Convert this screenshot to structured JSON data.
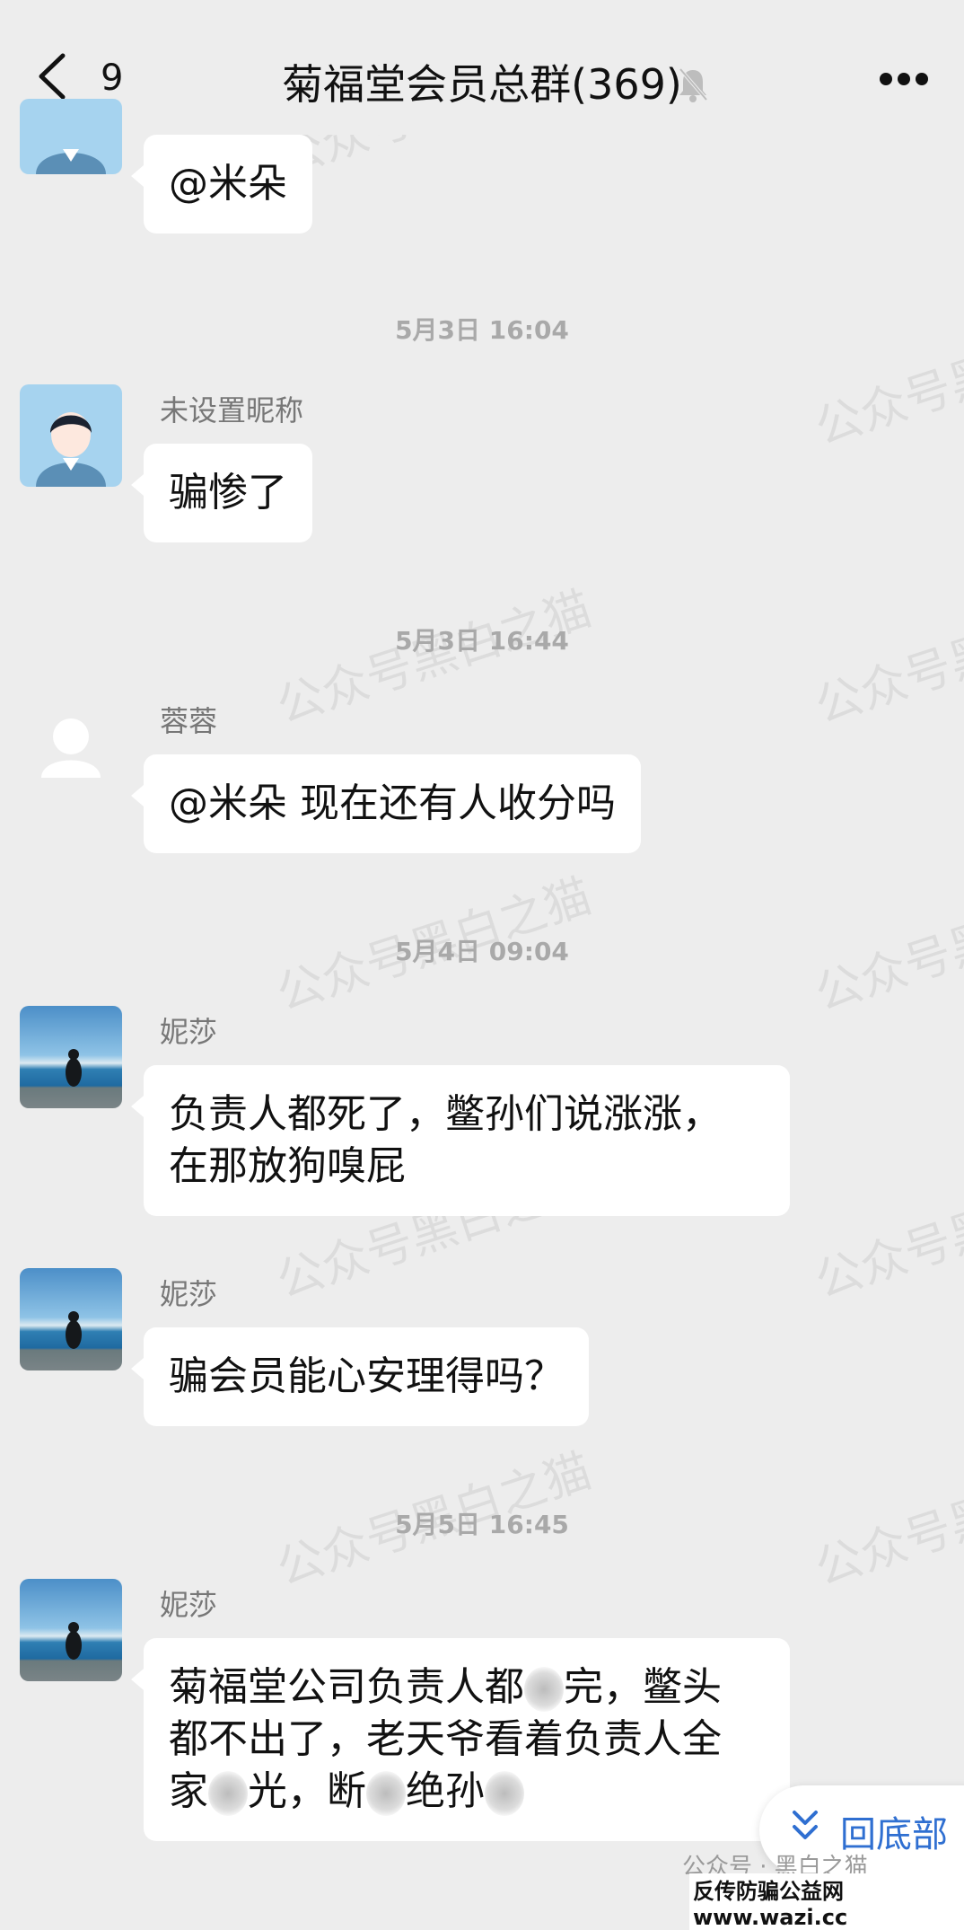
{
  "header": {
    "unread_count": "9",
    "title": "菊福堂会员总群(369)",
    "muted": true
  },
  "messages": [
    {
      "text": "@米朵"
    },
    {
      "time": "5月3日 16:04",
      "nickname": "未设置昵称",
      "text": "骗惨了"
    },
    {
      "time": "5月3日 16:44",
      "nickname": "蓉蓉",
      "text": "@米朵 现在还有人收分吗"
    },
    {
      "time": "5月4日 09:04",
      "nickname": "妮莎",
      "line1": "负责人都死了，鳖孙们说涨涨，",
      "line2": "在那放狗嗅屁"
    },
    {
      "nickname": "妮莎",
      "text": "骗会员能心安理得吗？"
    },
    {
      "time": "5月5日 16:45",
      "nickname": "妮莎",
      "line1a": "菊福堂公司负责人都",
      "line1b": "完，鳖头",
      "line2": "都不出了，老天爷看着负责人全",
      "line3a": "家",
      "line3b": "光，断",
      "line3c": "绝孙"
    }
  ],
  "watermark": "公众号黑白之猫",
  "to_bottom": {
    "label": "回底部"
  },
  "footer": {
    "source": "公众号 · 黑白之猫",
    "site": "反传防骗公益网 www.wazi.cc"
  },
  "colors": {
    "accent": "#2f6fd1",
    "background": "#ededed",
    "bubble": "#ffffff"
  }
}
